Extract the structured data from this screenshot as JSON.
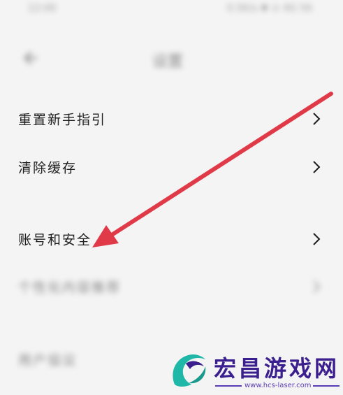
{
  "status_bar": {
    "time": "12:00",
    "right_text": "0.5K/s ✱ ⊙ 4G 56"
  },
  "header": {
    "title": "设置"
  },
  "menu": {
    "items": [
      {
        "label": "重置新手指引"
      },
      {
        "label": "清除缓存"
      },
      {
        "label": "账号和安全"
      },
      {
        "label": "个性化内容推荐"
      },
      {
        "label": "用户協议"
      }
    ]
  },
  "watermark": {
    "brand": "宏昌游戏网",
    "url": "www.hcs-laser.com"
  },
  "colors": {
    "background": "#f4f4f4",
    "arrow": "#e03a48",
    "watermark": "#3c1f8f",
    "logo_teal": "#1fb8a8"
  }
}
